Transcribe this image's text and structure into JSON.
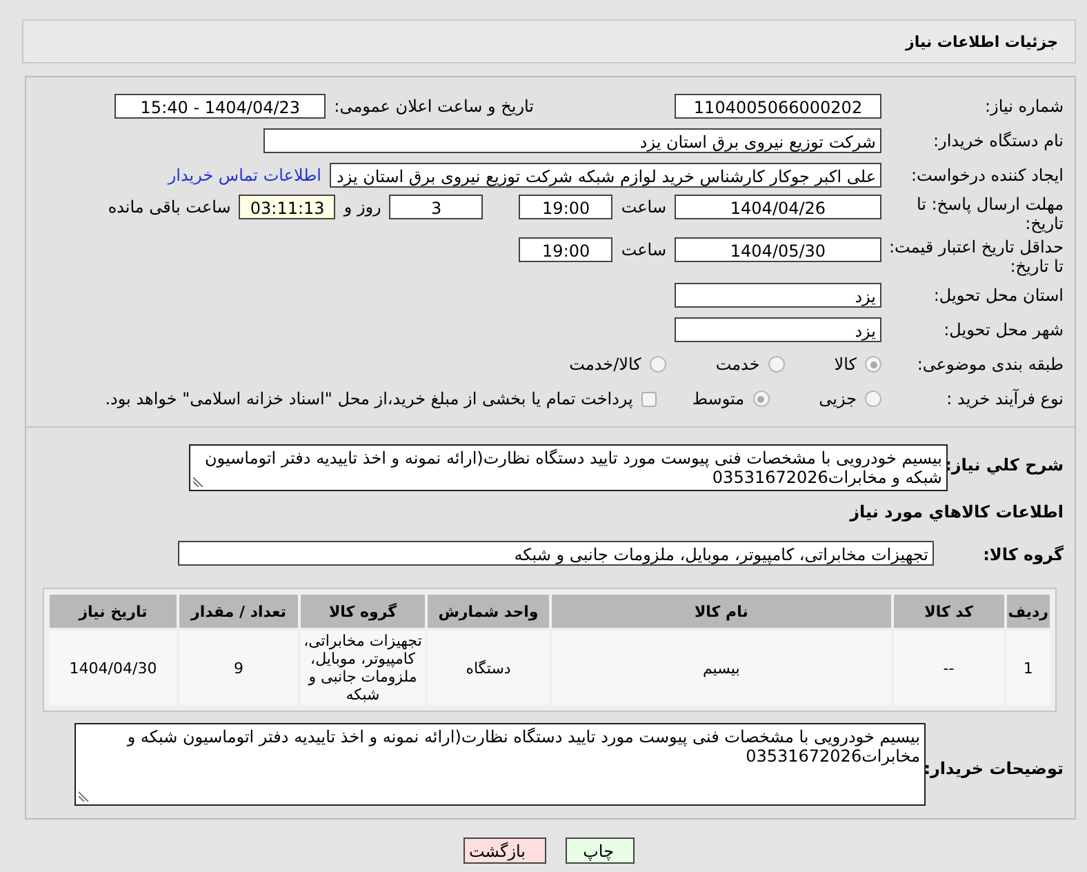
{
  "header": {
    "title": "جزئیات اطلاعات نیاز"
  },
  "need_number": {
    "label": "شماره نیاز:",
    "value": "1104005066000202"
  },
  "announce": {
    "label": "تاریخ و ساعت اعلان عمومی:",
    "value": "1404/04/23 - 15:40"
  },
  "buyer": {
    "label": "نام دستگاه خریدار:",
    "value": "شرکت توزیع نیروی برق استان یزد"
  },
  "requester": {
    "label": "ایجاد کننده درخواست:",
    "value": "علی اکبر  جوکار  کارشناس خرید لوازم شبکه  شرکت توزیع نیروی برق استان یزد",
    "link": "اطلاعات تماس خریدار"
  },
  "deadline": {
    "label": "مهلت ارسال پاسخ: تا تاریخ:",
    "date": "1404/04/26",
    "time_label": "ساعت",
    "time": "19:00",
    "days": "3",
    "days_label": "روز و",
    "remaining": "03:11:13",
    "remaining_label": "ساعت باقی مانده"
  },
  "validity": {
    "label": "حداقل تاریخ اعتبار قیمت: تا تاریخ:",
    "date": "1404/05/30",
    "time_label": "ساعت",
    "time": "19:00"
  },
  "province": {
    "label": "استان محل تحویل:",
    "value": "یزد"
  },
  "city": {
    "label": "شهر محل تحویل:",
    "value": "یزد"
  },
  "category": {
    "label": "طبقه بندی موضوعی:",
    "options": [
      {
        "label": "کالا",
        "selected": true
      },
      {
        "label": "خدمت",
        "selected": false
      },
      {
        "label": "کالا/خدمت",
        "selected": false
      }
    ]
  },
  "process": {
    "label": "نوع فرآیند خرید :",
    "options": [
      {
        "label": "جزیی",
        "selected": false
      },
      {
        "label": "متوسط",
        "selected": true
      }
    ],
    "payment": {
      "label": "پرداخت تمام یا بخشی از مبلغ خرید،از محل \"اسناد خزانه اسلامی\" خواهد بود.",
      "checked": false
    }
  },
  "description": {
    "label": "شرح كلي نياز:",
    "value": "بیسیم خودرویی با  مشخصات فنی پیوست مورد تایید دستگاه نظارت(ارائه نمونه و اخذ تاییدیه دفتر اتوماسیون شبکه و مخابرات03531672026"
  },
  "goods_title": "اطلاعات كالاهاي مورد نياز",
  "goods_group": {
    "label": "گروه کالا:",
    "value": "تجهیزات مخابراتی، کامپیوتر، موبایل، ملزومات جانبی و شبکه"
  },
  "table": {
    "columns": [
      "ردیف",
      "کد کالا",
      "نام کالا",
      "واحد شمارش",
      "گروه کالا",
      "تعداد / مقدار",
      "تاریخ نیاز"
    ],
    "rows": [
      [
        "1",
        "--",
        "بیسیم",
        "دستگاه",
        "تجهیزات مخابراتی، کامپیوتر، موبایل، ملزومات جانبی و شبکه",
        "9",
        "1404/04/30"
      ]
    ]
  },
  "buyer_notes": {
    "label": "توضیحات خریدار:",
    "value": "بیسیم خودرویی با  مشخصات فنی پیوست مورد تایید دستگاه نظارت(ارائه نمونه و اخذ تاییدیه دفتر اتوماسیون شبکه و مخابرات03531672026"
  },
  "buttons": [
    {
      "label": "چاپ",
      "kind": "print"
    },
    {
      "label": "بازگشت",
      "kind": "back"
    }
  ]
}
